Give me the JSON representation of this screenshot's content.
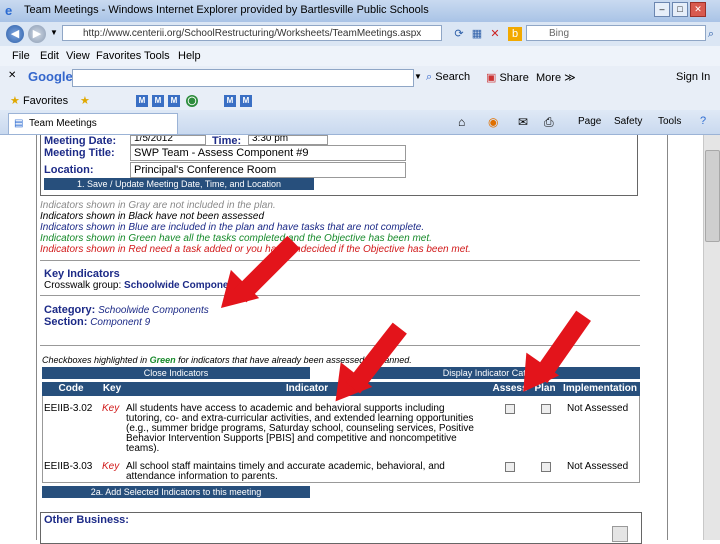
{
  "window": {
    "title": "Team Meetings - Windows Internet Explorer provided by Bartlesville Public Schools",
    "min": "–",
    "max": "□",
    "close": "✕"
  },
  "address": {
    "url": "http://www.centerii.org/SchoolRestructuring/Worksheets/TeamMeetings.aspx",
    "search_placeholder": "Bing"
  },
  "menu": [
    "File",
    "Edit",
    "View",
    "Favorites",
    "Tools",
    "Help"
  ],
  "google_bar": {
    "logo": "Google",
    "search": "Search",
    "share": "Share",
    "more": "More ≫",
    "signin": "Sign In"
  },
  "favorites": {
    "label": "Favorites"
  },
  "tab": {
    "label": "Team Meetings"
  },
  "commandbar": {
    "page": "Page",
    "safety": "Safety",
    "tools": "Tools"
  },
  "form": {
    "meeting_date_label": "Meeting Date:",
    "meeting_date_value": "1/5/2012",
    "time_label": "Time:",
    "time_value": "3:30 pm",
    "meeting_title_label": "Meeting Title:",
    "meeting_title_value": "SWP Team - Assess Component #9",
    "location_label": "Location:",
    "location_value": "Principal's Conference Room",
    "save_button": "1. Save / Update Meeting Date, Time, and Location"
  },
  "indicator_legend": [
    {
      "text": "Indicators shown in Gray are not included in the plan.",
      "color": "#8a8a8a"
    },
    {
      "text": "Indicators shown in Black have not been assessed",
      "color": "#000000"
    },
    {
      "text": "Indicators shown in Blue are included in the plan and have tasks that are not complete.",
      "color": "#1c2a87"
    },
    {
      "text": "Indicators shown in Green have all the tasks completed and the Objective has been met.",
      "color": "#178a2a"
    },
    {
      "text": "Indicators shown in Red need a task added or you have undecided if the Objective has been met.",
      "color": "#d11a1a"
    }
  ],
  "key_indicators": {
    "title": "Key Indicators",
    "crosswalk_label": "Crosswalk group:",
    "crosswalk_value": "Schoolwide Components",
    "category_label": "Category:",
    "category_value": "Schoolwide Components",
    "section_label": "Section:",
    "section_value": "Component 9"
  },
  "checkbox_note": {
    "prefix": "Checkboxes highlighted in ",
    "green": "Green",
    "suffix": " for indicators that have already been assessed or planned."
  },
  "buttons": {
    "close_indicators": "Close Indicators",
    "display_categories": "Display Indicator Categories",
    "add_selected": "2a. Add Selected Indicators to this meeting"
  },
  "table": {
    "headers": {
      "code": "Code",
      "key": "Key",
      "indicator": "Indicator",
      "assess": "Assess",
      "plan": "Plan",
      "implementation": "Implementation"
    },
    "rows": [
      {
        "code": "EEIIB-3.02",
        "key": "Key",
        "lines": [
          "All students have access to academic and behavioral supports including",
          "tutoring, co- and extra-curricular activities, and extended learning opportunities",
          "(e.g., summer bridge programs, Saturday school, counseling services, Positive",
          "Behavior Intervention Supports [PBIS] and competitive and noncompetitive",
          "teams)."
        ],
        "implementation": "Not Assessed"
      },
      {
        "code": "EEIIB-3.03",
        "key": "Key",
        "lines": [
          "All school staff maintains timely and accurate academic, behavioral, and",
          "attendance information to parents."
        ],
        "implementation": "Not Assessed"
      }
    ]
  },
  "other_business": {
    "label": "Other Business:"
  },
  "colors": {
    "arrow": "#e3141b",
    "header": "#274f7c",
    "label_blue": "#1c2a87",
    "key_red": "#d11a1a"
  }
}
